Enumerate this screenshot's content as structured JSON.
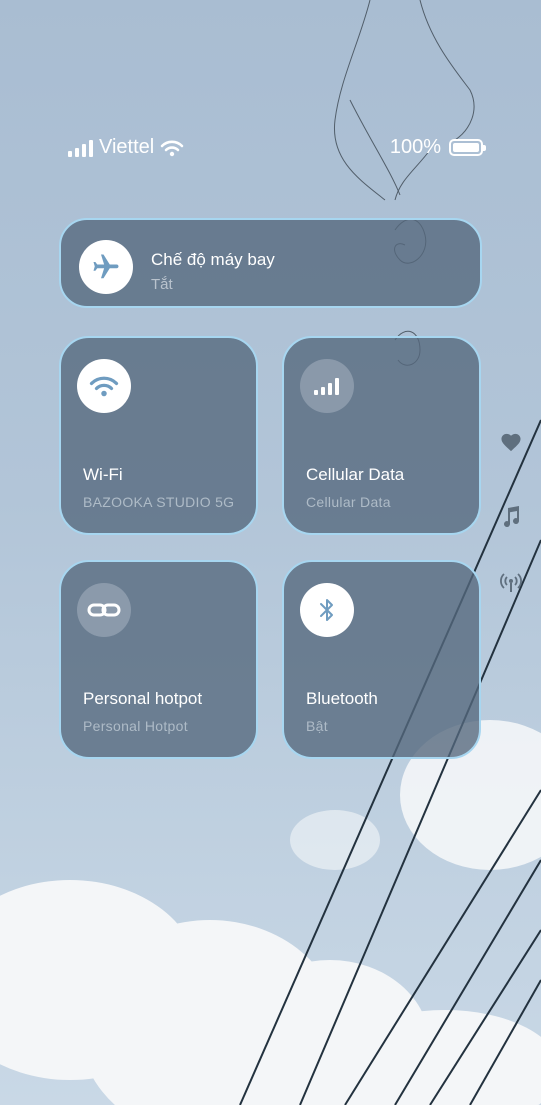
{
  "status_bar": {
    "carrier": "Viettel",
    "battery_percent": "100%",
    "battery_level": 1.0
  },
  "airplane_mode": {
    "title": "Chế độ máy bay",
    "status": "Tắt",
    "icon": "airplane-icon",
    "enabled": false
  },
  "tiles": {
    "wifi": {
      "title": "Wi-Fi",
      "subtitle": "BAZOOKA STUDIO 5G",
      "icon": "wifi-icon",
      "enabled": true
    },
    "cellular": {
      "title": "Cellular Data",
      "subtitle": "Cellular Data",
      "icon": "cellular-bars-icon",
      "enabled": false
    },
    "hotspot": {
      "title": "Personal hotpot",
      "subtitle": "Personal Hotpot",
      "icon": "link-icon",
      "enabled": false
    },
    "bluetooth": {
      "title": "Bluetooth",
      "subtitle": "Bật",
      "icon": "bluetooth-icon",
      "enabled": true
    }
  },
  "side_icons": [
    "heart-icon",
    "music-note-icon",
    "broadcast-icon"
  ],
  "colors": {
    "tile_bg": "#54687c",
    "tile_border": "#a7d6f0",
    "icon_blue": "#6f9cc0"
  }
}
